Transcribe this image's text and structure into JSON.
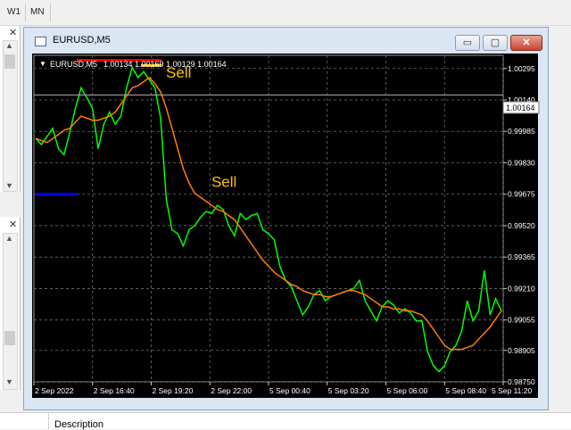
{
  "toolbar": {
    "timeframes": [
      "W1",
      "MN"
    ]
  },
  "window": {
    "title": "EURUSD,M5"
  },
  "chart_info": {
    "symbol": "EURUSD,M5",
    "ohlc": "1.00134 1.00169 1.00129 1.00164"
  },
  "price_label": "1.00164",
  "bottom_panel": {
    "description": "Description"
  },
  "icons": {
    "close": "✕",
    "minimize": "▭",
    "maximize": "▢",
    "scroll_up": "▲",
    "scroll_down": "▼"
  },
  "colors": {
    "price": "#00ff00",
    "ma": "#ff7f00",
    "signal": "#ffc000",
    "background": "#000000",
    "grid": "#707070"
  },
  "chart_data": {
    "type": "line",
    "title": "",
    "y_ticks": [
      "1.00295",
      "1.00140",
      "0.99985",
      "0.99830",
      "0.99675",
      "0.99520",
      "0.99365",
      "0.99210",
      "0.99055",
      "0.98905",
      "0.98750"
    ],
    "x_ticks": [
      "2 Sep 2022",
      "2 Sep 16:40",
      "2 Sep 19:20",
      "2 Sep 22:00",
      "5 Sep 00:40",
      "5 Sep 03:20",
      "5 Sep 06:00",
      "5 Sep 08:40",
      "5 Sep 11:20"
    ],
    "ylim": [
      0.9875,
      1.0036
    ],
    "current_price": 1.00164,
    "series": [
      {
        "name": "",
        "values": [
          0.9995,
          0.9992,
          0.9996,
          1.0,
          0.999,
          0.9987,
          0.9998,
          1.001,
          1.002,
          1.0015,
          1.001,
          0.999,
          1.0002,
          1.0008,
          1.0002,
          1.0006,
          1.002,
          1.003,
          1.0025,
          1.0028,
          1.0024,
          1.002,
          1.0005,
          0.9965,
          0.995,
          0.9948,
          0.9942,
          0.995,
          0.9952,
          0.9956,
          0.9959,
          0.9958,
          0.9962,
          0.996,
          0.9952,
          0.9947,
          0.9958,
          0.9955,
          0.9957,
          0.9958,
          0.995,
          0.9948,
          0.9945,
          0.9932,
          0.9925,
          0.9922,
          0.9915,
          0.9908,
          0.9912,
          0.9918,
          0.992,
          0.9915,
          0.9917,
          0.9918,
          0.9919,
          0.992,
          0.9921,
          0.9925,
          0.9915,
          0.991,
          0.9905,
          0.9912,
          0.9915,
          0.9913,
          0.9909,
          0.9911,
          0.9909,
          0.9905,
          0.9905,
          0.989,
          0.9883,
          0.988,
          0.9883,
          0.989,
          0.9893,
          0.99,
          0.9915,
          0.9905,
          0.991,
          0.993,
          0.9908,
          0.9916,
          0.991
        ]
      },
      {
        "name": "",
        "values": [
          0.9995,
          0.9994,
          0.9993,
          0.9995,
          0.9997,
          0.9999,
          1.0,
          1.0003,
          1.0006,
          1.0005,
          1.0004,
          1.0004,
          1.0005,
          1.0006,
          1.0008,
          1.0012,
          1.0016,
          1.002,
          1.0021,
          1.0023,
          1.0025,
          1.0022,
          1.0018,
          1.001,
          1.0,
          0.999,
          0.998,
          0.9973,
          0.9968,
          0.9966,
          0.9964,
          0.9962,
          0.996,
          0.9959,
          0.9957,
          0.9955,
          0.9951,
          0.9947,
          0.9943,
          0.9939,
          0.9935,
          0.9932,
          0.9929,
          0.9927,
          0.9925,
          0.9923,
          0.9922,
          0.992,
          0.9919,
          0.9918,
          0.9918,
          0.9917,
          0.9917,
          0.9918,
          0.9919,
          0.992,
          0.992,
          0.9919,
          0.9918,
          0.9916,
          0.9914,
          0.9912,
          0.9912,
          0.9911,
          0.9911,
          0.991,
          0.991,
          0.9909,
          0.9908,
          0.9905,
          0.9901,
          0.9897,
          0.9893,
          0.9891,
          0.9891,
          0.9891,
          0.9892,
          0.9893,
          0.9896,
          0.9899,
          0.9902,
          0.9906,
          0.991
        ]
      }
    ],
    "sell_signals": [
      {
        "label": "Sell",
        "index": 22
      },
      {
        "label": "Sell",
        "index": 30
      }
    ],
    "levels": [
      {
        "color": "#ff0000",
        "value": 1.00335
      },
      {
        "color": "#ffc000",
        "value": 1.0031
      },
      {
        "color": "#0000ff",
        "value": 0.99675
      }
    ],
    "grid": true
  }
}
